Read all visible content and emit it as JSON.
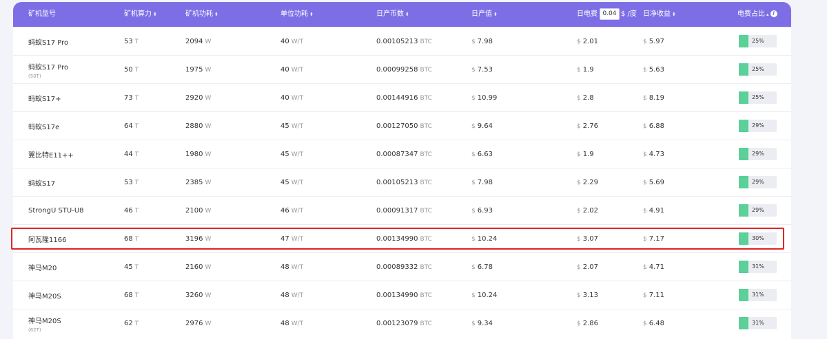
{
  "header": {
    "model": "矿机型号",
    "hashrate": "矿机算力",
    "power": "矿机功耗",
    "efficiency": "单位功耗",
    "daily_coins": "日产币数",
    "daily_output": "日产值",
    "electricity_label": "日电费",
    "electricity_price": "0.04",
    "electricity_unit": "$ /度",
    "daily_net": "日净收益",
    "electricity_ratio": "电费占比"
  },
  "units": {
    "hashrate": "T",
    "power": "W",
    "efficiency": "W/T",
    "coin": "BTC",
    "currency": "$"
  },
  "rows": [
    {
      "model": "蚂蚁S17 Pro",
      "sub": "",
      "hashrate": "53",
      "power": "2094",
      "efficiency": "40",
      "coins": "0.00105213",
      "output": "7.98",
      "electricity": "2.01",
      "net": "5.97",
      "ratio": "25%"
    },
    {
      "model": "蚂蚁S17 Pro",
      "sub": "(50T)",
      "hashrate": "50",
      "power": "1975",
      "efficiency": "40",
      "coins": "0.00099258",
      "output": "7.53",
      "electricity": "1.9",
      "net": "5.63",
      "ratio": "25%"
    },
    {
      "model": "蚂蚁S17+",
      "sub": "",
      "hashrate": "73",
      "power": "2920",
      "efficiency": "40",
      "coins": "0.00144916",
      "output": "10.99",
      "electricity": "2.8",
      "net": "8.19",
      "ratio": "25%"
    },
    {
      "model": "蚂蚁S17e",
      "sub": "",
      "hashrate": "64",
      "power": "2880",
      "efficiency": "45",
      "coins": "0.00127050",
      "output": "9.64",
      "electricity": "2.76",
      "net": "6.88",
      "ratio": "29%"
    },
    {
      "model": "翼比特E11++",
      "sub": "",
      "hashrate": "44",
      "power": "1980",
      "efficiency": "45",
      "coins": "0.00087347",
      "output": "6.63",
      "electricity": "1.9",
      "net": "4.73",
      "ratio": "29%"
    },
    {
      "model": "蚂蚁S17",
      "sub": "",
      "hashrate": "53",
      "power": "2385",
      "efficiency": "45",
      "coins": "0.00105213",
      "output": "7.98",
      "electricity": "2.29",
      "net": "5.69",
      "ratio": "29%"
    },
    {
      "model": "StrongU STU-U8",
      "sub": "",
      "hashrate": "46",
      "power": "2100",
      "efficiency": "46",
      "coins": "0.00091317",
      "output": "6.93",
      "electricity": "2.02",
      "net": "4.91",
      "ratio": "29%"
    },
    {
      "model": "阿瓦隆1166",
      "sub": "",
      "hashrate": "68",
      "power": "3196",
      "efficiency": "47",
      "coins": "0.00134990",
      "output": "10.24",
      "electricity": "3.07",
      "net": "7.17",
      "ratio": "30%"
    },
    {
      "model": "神马M20",
      "sub": "",
      "hashrate": "45",
      "power": "2160",
      "efficiency": "48",
      "coins": "0.00089332",
      "output": "6.78",
      "electricity": "2.07",
      "net": "4.71",
      "ratio": "31%"
    },
    {
      "model": "神马M20S",
      "sub": "",
      "hashrate": "68",
      "power": "3260",
      "efficiency": "48",
      "coins": "0.00134990",
      "output": "10.24",
      "electricity": "3.13",
      "net": "7.11",
      "ratio": "31%"
    },
    {
      "model": "神马M20S",
      "sub": "(62T)",
      "hashrate": "62",
      "power": "2976",
      "efficiency": "48",
      "coins": "0.00123079",
      "output": "9.34",
      "electricity": "2.86",
      "net": "6.48",
      "ratio": "31%"
    }
  ],
  "colors": {
    "header_bg": "#7e6ee6",
    "bar_fill": "#5bd098",
    "highlight": "#e02424"
  },
  "icons": {
    "sort": "sort-arrows-icon",
    "info": "info-icon"
  }
}
